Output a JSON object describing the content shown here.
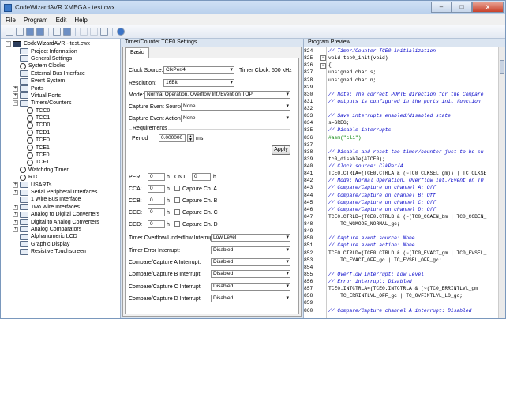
{
  "window": {
    "title": "CodeWizardAVR XMEGA - test.cwx",
    "min": "–",
    "max": "□",
    "close": "x"
  },
  "menu": [
    "File",
    "Program",
    "Edit",
    "Help"
  ],
  "tree": {
    "items": [
      {
        "label": "CodeWizardAVR - test.cwx",
        "toggle": "−",
        "icon": "chip-icon",
        "level": 0
      },
      {
        "label": "Project Information",
        "toggle": "",
        "icon": "info-icon",
        "level": 1
      },
      {
        "label": "General Settings",
        "toggle": "",
        "icon": "settings-icon",
        "level": 1
      },
      {
        "label": "System Clocks",
        "toggle": "",
        "icon": "clock-icon",
        "level": 1
      },
      {
        "label": "External Bus Interface",
        "toggle": "",
        "icon": "bus-icon",
        "level": 1
      },
      {
        "label": "Event System",
        "toggle": "",
        "icon": "event-icon",
        "level": 1
      },
      {
        "label": "Ports",
        "toggle": "+",
        "icon": "ports-icon",
        "level": 1
      },
      {
        "label": "Virtual Ports",
        "toggle": "+",
        "icon": "ports-icon",
        "level": 1
      },
      {
        "label": "Timers/Counters",
        "toggle": "−",
        "icon": "timer-icon",
        "level": 1
      },
      {
        "label": "TCC0",
        "toggle": "",
        "icon": "clock-icon",
        "level": 2
      },
      {
        "label": "TCC1",
        "toggle": "",
        "icon": "clock-icon",
        "level": 2
      },
      {
        "label": "TCD0",
        "toggle": "",
        "icon": "clock-icon",
        "level": 2
      },
      {
        "label": "TCD1",
        "toggle": "",
        "icon": "clock-icon",
        "level": 2
      },
      {
        "label": "TCE0",
        "toggle": "",
        "icon": "clock-icon",
        "level": 2
      },
      {
        "label": "TCE1",
        "toggle": "",
        "icon": "clock-icon",
        "level": 2
      },
      {
        "label": "TCF0",
        "toggle": "",
        "icon": "clock-icon",
        "level": 2
      },
      {
        "label": "TCF1",
        "toggle": "",
        "icon": "clock-icon",
        "level": 2
      },
      {
        "label": "Watchdog Timer",
        "toggle": "",
        "icon": "clock-icon",
        "level": 1
      },
      {
        "label": "RTC",
        "toggle": "",
        "icon": "clock-icon",
        "level": 1
      },
      {
        "label": "USARTs",
        "toggle": "+",
        "icon": "usart-icon",
        "level": 1
      },
      {
        "label": "Serial Peripheral Interfaces",
        "toggle": "+",
        "icon": "spi-icon",
        "level": 1
      },
      {
        "label": "1 Wire Bus Interface",
        "toggle": "",
        "icon": "wire-icon",
        "level": 1
      },
      {
        "label": "Two Wire Interfaces",
        "toggle": "+",
        "icon": "twi-icon",
        "level": 1
      },
      {
        "label": "Analog to Digital Converters",
        "toggle": "+",
        "icon": "adc-icon",
        "level": 1
      },
      {
        "label": "Digital to Analog Converters",
        "toggle": "+",
        "icon": "dac-icon",
        "level": 1
      },
      {
        "label": "Analog Comparators",
        "toggle": "+",
        "icon": "comparator-icon",
        "level": 1
      },
      {
        "label": "Alphanumeric LCD",
        "toggle": "",
        "icon": "lcd-icon",
        "level": 1
      },
      {
        "label": "Graphic Display",
        "toggle": "",
        "icon": "display-icon",
        "level": 1
      },
      {
        "label": "Resistive Touchscreen",
        "toggle": "",
        "icon": "touch-icon",
        "level": 1
      }
    ]
  },
  "settings": {
    "header": "Timer/Counter TCE0 Settings",
    "tab": "Basic",
    "clock_source_label": "Clock Source:",
    "clock_source_value": "ClkPer/4",
    "timer_clock_text": "Timer Clock: 500 kHz",
    "resolution_label": "Resolution:",
    "resolution_value": "16Bit",
    "mode_label": "Mode:",
    "mode_value": "Normal Operation, Overflow Int./Event on TOP",
    "capture_source_label": "Capture Event Source:",
    "capture_source_value": "None",
    "capture_action_label": "Capture Event Action:",
    "capture_action_value": "None",
    "requirements_label": "Requirements",
    "period_label": "Period",
    "period_value": "0.000000",
    "period_unit": "ms",
    "apply_label": "Apply",
    "per_label": "PER:",
    "per_value": "0",
    "h": "h",
    "cnt_label": "CNT:",
    "cnt_value": "0",
    "cca_label": "CCA:",
    "cca_value": "0",
    "cap_a": "Capture Ch. A",
    "ccb_label": "CCB:",
    "ccb_value": "0",
    "cap_b": "Capture Ch. B",
    "ccc_label": "CCC:",
    "ccc_value": "0",
    "cap_c": "Capture Ch. C",
    "ccd_label": "CCD:",
    "ccd_value": "0",
    "cap_d": "Capture Ch. D",
    "ovf_label": "Timer Overflow/Underflow Interrupt:",
    "ovf_value": "Low Level",
    "err_label": "Timer Error Interrupt:",
    "err_value": "Disabled",
    "cca_int_label": "Compare/Capture A Interrupt:",
    "cca_int_value": "Disabled",
    "ccb_int_label": "Compare/Capture B Interrupt:",
    "ccb_int_value": "Disabled",
    "ccc_int_label": "Compare/Capture C Interrupt:",
    "ccc_int_value": "Disabled",
    "ccd_int_label": "Compare/Capture D Interrupt:",
    "ccd_int_value": "Disabled"
  },
  "code": {
    "header": "Program Preview",
    "lines": [
      {
        "n": "824",
        "t": "// Timer/Counter TCE0 initialization",
        "c": "com",
        "f": ""
      },
      {
        "n": "825",
        "t": "void tce0_init(void)",
        "c": "kw",
        "f": "−"
      },
      {
        "n": "826",
        "t": "{",
        "c": "kw",
        "f": "−"
      },
      {
        "n": "827",
        "t": "unsigned char s;",
        "c": "kw",
        "f": ""
      },
      {
        "n": "828",
        "t": "unsigned char n;",
        "c": "kw",
        "f": ""
      },
      {
        "n": "829",
        "t": "",
        "c": "kw",
        "f": ""
      },
      {
        "n": "830",
        "t": "// Note: The correct PORTE direction for the Compare",
        "c": "com",
        "f": ""
      },
      {
        "n": "831",
        "t": "// outputs is configured in the ports_init function.",
        "c": "com",
        "f": ""
      },
      {
        "n": "832",
        "t": "",
        "c": "kw",
        "f": ""
      },
      {
        "n": "833",
        "t": "// Save interrupts enabled/disabled state",
        "c": "com",
        "f": ""
      },
      {
        "n": "834",
        "t": "s=SREG;",
        "c": "kw",
        "f": ""
      },
      {
        "n": "835",
        "t": "// Disable interrupts",
        "c": "com",
        "f": ""
      },
      {
        "n": "836",
        "t": "#asm(\"cli\")",
        "c": "asm",
        "f": ""
      },
      {
        "n": "837",
        "t": "",
        "c": "kw",
        "f": ""
      },
      {
        "n": "838",
        "t": "// Disable and reset the timer/counter just to be su",
        "c": "com",
        "f": ""
      },
      {
        "n": "839",
        "t": "tc0_disable(&TCE0);",
        "c": "kw",
        "f": ""
      },
      {
        "n": "840",
        "t": "// Clock source: ClkPer/4",
        "c": "com",
        "f": ""
      },
      {
        "n": "841",
        "t": "TCE0.CTRLA=(TCE0.CTRLA & (~TC0_CLKSEL_gm)) | TC_CLKSE",
        "c": "kw",
        "f": ""
      },
      {
        "n": "842",
        "t": "// Mode: Normal Operation, Overflow Int./Event on TO",
        "c": "com",
        "f": ""
      },
      {
        "n": "843",
        "t": "// Compare/Capture on channel A: Off",
        "c": "com",
        "f": ""
      },
      {
        "n": "844",
        "t": "// Compare/Capture on channel B: Off",
        "c": "com",
        "f": ""
      },
      {
        "n": "845",
        "t": "// Compare/Capture on channel C: Off",
        "c": "com",
        "f": ""
      },
      {
        "n": "846",
        "t": "// Compare/Capture on channel D: Off",
        "c": "com",
        "f": ""
      },
      {
        "n": "847",
        "t": "TCE0.CTRLB=(TCE0.CTRLB & (~(TC0_CCAEN_bm | TC0_CCBEN_",
        "c": "kw",
        "f": ""
      },
      {
        "n": "848",
        "t": "    TC_WGMODE_NORMAL_gc;",
        "c": "kw",
        "f": ""
      },
      {
        "n": "849",
        "t": "",
        "c": "kw",
        "f": ""
      },
      {
        "n": "850",
        "t": "// Capture event source: None",
        "c": "com",
        "f": ""
      },
      {
        "n": "851",
        "t": "// Capture event action: None",
        "c": "com",
        "f": ""
      },
      {
        "n": "852",
        "t": "TCE0.CTRLD=(TCE0.CTRLD & (~(TC0_EVACT_gm | TC0_EVSEL_",
        "c": "kw",
        "f": ""
      },
      {
        "n": "853",
        "t": "    TC_EVACT_OFF_gc | TC_EVSEL_OFF_gc;",
        "c": "kw",
        "f": ""
      },
      {
        "n": "854",
        "t": "",
        "c": "kw",
        "f": ""
      },
      {
        "n": "855",
        "t": "// Overflow interrupt: Low Level",
        "c": "com",
        "f": ""
      },
      {
        "n": "856",
        "t": "// Error interrupt: Disabled",
        "c": "com",
        "f": ""
      },
      {
        "n": "857",
        "t": "TCE0.INTCTRLA=(TCE0.INTCTRLA & (~(TC0_ERRINTLVL_gm |",
        "c": "kw",
        "f": ""
      },
      {
        "n": "858",
        "t": "    TC_ERRINTLVL_OFF_gc | TC_OVFINTLVL_LO_gc;",
        "c": "kw",
        "f": ""
      },
      {
        "n": "859",
        "t": "",
        "c": "kw",
        "f": ""
      },
      {
        "n": "860",
        "t": "// Compare/Capture channel A interrupt: Disabled",
        "c": "com",
        "f": ""
      }
    ]
  }
}
